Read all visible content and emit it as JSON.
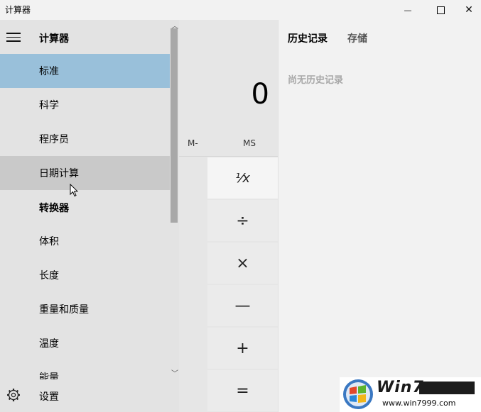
{
  "window": {
    "title": "计算器",
    "minimize_glyph": "—",
    "close_glyph": "✕"
  },
  "display": {
    "value": "0"
  },
  "memory": {
    "m_minus": "M-",
    "ms": "MS"
  },
  "keys": {
    "reciprocal": "¹⁄x",
    "divide": "÷",
    "multiply": "×",
    "subtract": "—",
    "add": "+",
    "equals": "="
  },
  "history": {
    "tab_history": "历史记录",
    "tab_memory": "存储",
    "empty": "尚无历史记录"
  },
  "nav": {
    "title": "计算器",
    "items": [
      {
        "label": "标准",
        "state": "selected"
      },
      {
        "label": "科学"
      },
      {
        "label": "程序员"
      },
      {
        "label": "日期计算",
        "state": "hover"
      },
      {
        "label": "转换器",
        "section": true
      },
      {
        "label": "体积"
      },
      {
        "label": "长度"
      },
      {
        "label": "重量和质量"
      },
      {
        "label": "温度"
      },
      {
        "label": "能量"
      }
    ],
    "settings": "设置",
    "scroll_up": "︿",
    "scroll_down": "﹀"
  },
  "watermark": {
    "text": "Win7",
    "url": "www.win7999.com"
  },
  "colors": {
    "selected": "#99c0da",
    "hover": "#c9c9c9",
    "nav_bg": "#e3e3e3"
  }
}
